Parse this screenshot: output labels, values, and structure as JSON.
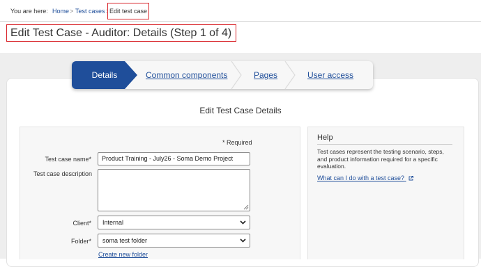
{
  "breadcrumb": {
    "label": "You are here:",
    "home": "Home",
    "sep": ">",
    "test_cases": "Test cases",
    "sep2": ">",
    "current": "Edit test case"
  },
  "page_title": "Edit Test Case -  Auditor: Details (Step 1 of 4)",
  "wizard": {
    "steps": [
      {
        "label": "Details",
        "state": "active"
      },
      {
        "label": "Common components",
        "state": "link"
      },
      {
        "label": "Pages",
        "state": "link"
      },
      {
        "label": "User access",
        "state": "link"
      }
    ]
  },
  "form": {
    "heading": "Edit Test Case Details",
    "required_note": "* Required",
    "name_label": "Test case name*",
    "name_value": "Product Training - July26 - Soma Demo Project",
    "description_label": "Test case description",
    "description_value": "",
    "client_label": "Client*",
    "client_value": "Internal",
    "folder_label": "Folder*",
    "folder_value": "soma test folder",
    "create_folder_link": "Create new folder"
  },
  "help": {
    "title": "Help",
    "text": "Test cases represent the testing scenario, steps, and product information required for a specific evaluation.",
    "link": "What can I do with a test case?"
  },
  "colors": {
    "brand": "#1f4e9a",
    "highlight": "#d9262c"
  }
}
